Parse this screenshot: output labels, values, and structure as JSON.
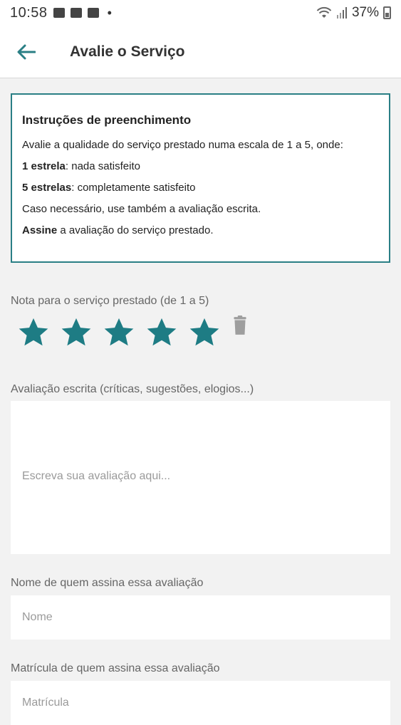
{
  "status_bar": {
    "time": "10:58",
    "battery": "37%",
    "dot": "•"
  },
  "app_bar": {
    "title": "Avalie o Serviço"
  },
  "instructions": {
    "title": "Instruções de preenchimento",
    "line1": "Avalie a qualidade do serviço prestado numa escala de 1 a 5, onde:",
    "line2_bold": "1 estrela",
    "line2_rest": ": nada satisfeito",
    "line3_bold": "5 estrelas",
    "line3_rest": ": completamente satisfeito",
    "line4": "Caso necessário, use também a avaliação escrita.",
    "line5_bold": "Assine",
    "line5_rest": " a avaliação do serviço prestado."
  },
  "rating": {
    "label": "Nota para o serviço prestado (de 1 a 5)",
    "value": 5,
    "max": 5,
    "star_color": "#1e7c84"
  },
  "written_review": {
    "label": "Avaliação escrita (críticas, sugestões, elogios...)",
    "placeholder": "Escreva sua avaliação aqui...",
    "value": ""
  },
  "signer_name": {
    "label": "Nome de quem assina essa avaliação",
    "placeholder": "Nome",
    "value": ""
  },
  "signer_registration": {
    "label": "Matrícula de quem assina essa avaliação",
    "placeholder": "Matrícula",
    "value": ""
  },
  "colors": {
    "accent": "#2a7f85",
    "background": "#f2f2f2"
  }
}
